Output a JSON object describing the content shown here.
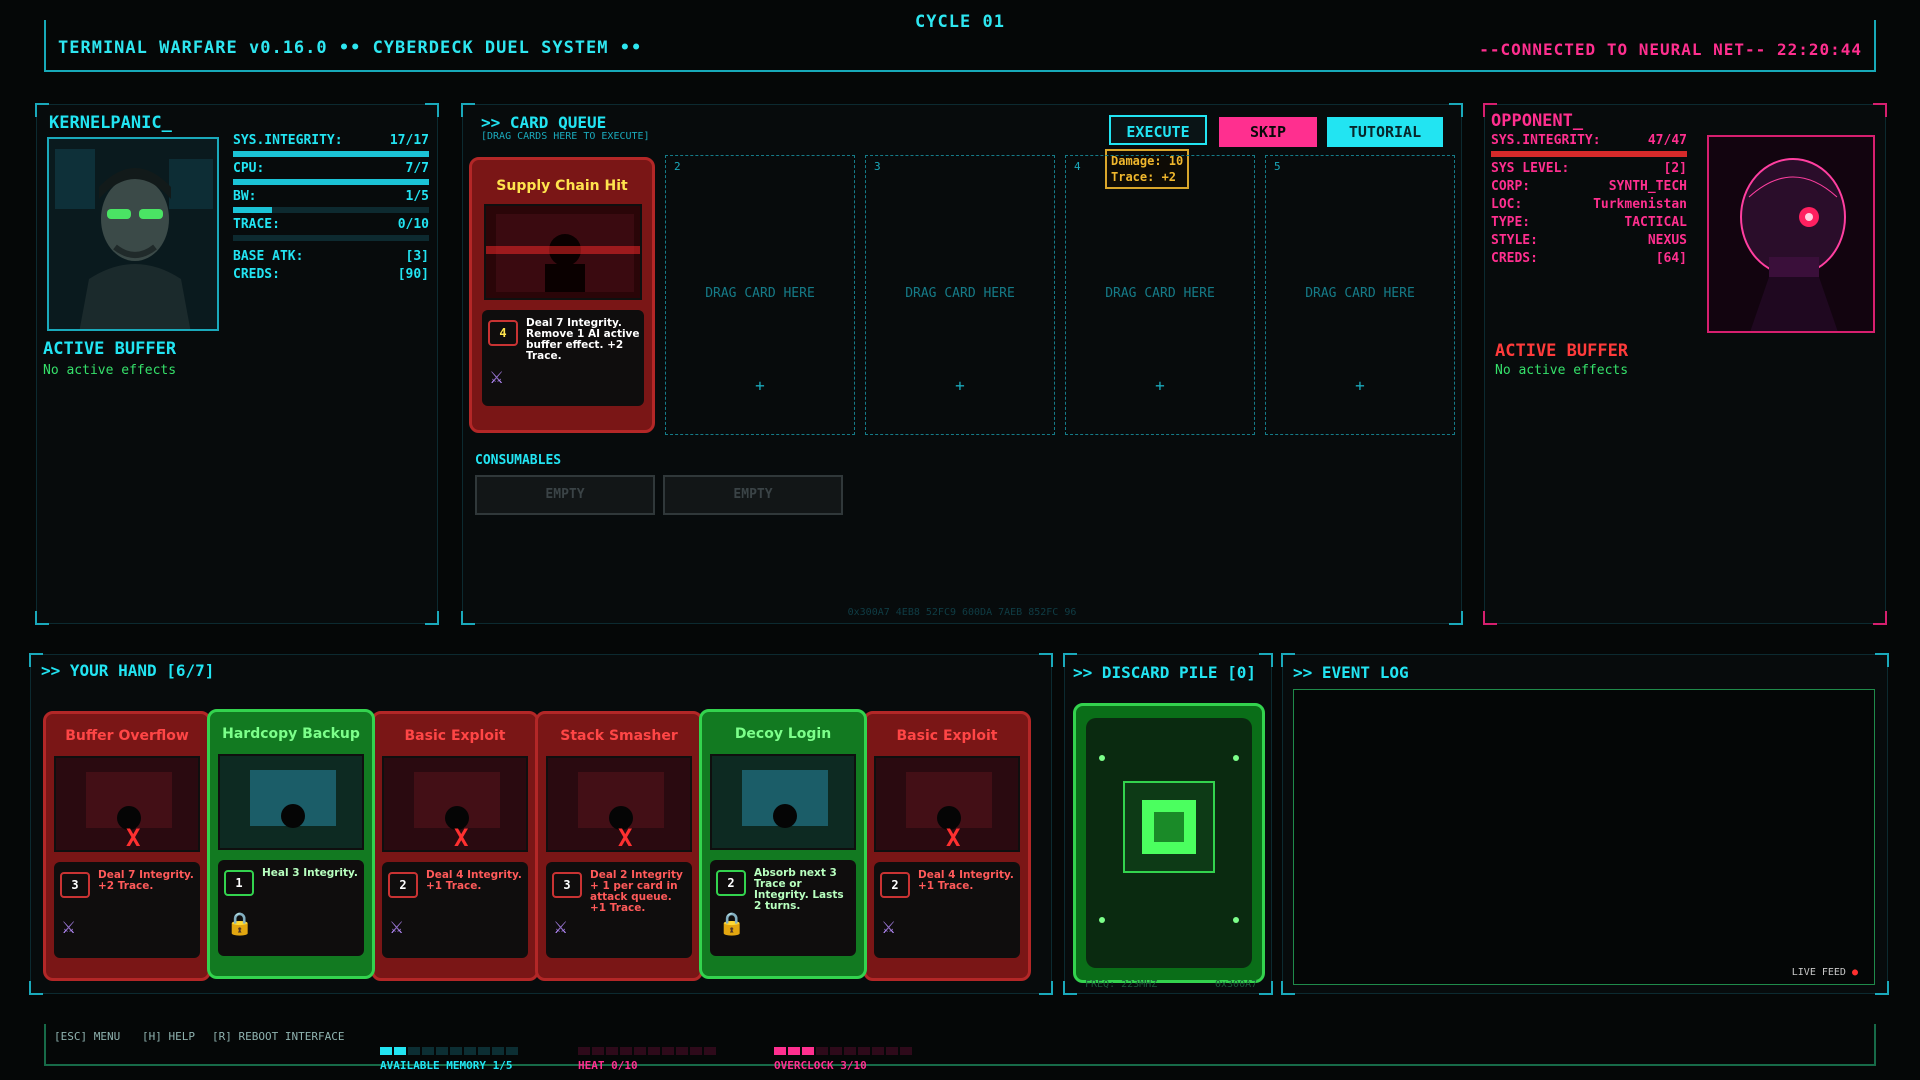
{
  "header": {
    "title": "TERMINAL WARFARE  v0.16.0  •• CYBERDECK DUEL SYSTEM ••",
    "cycle": "CYCLE 01",
    "connection": "--CONNECTED TO NEURAL NET--  22:20:44"
  },
  "player": {
    "name": "KERNELPANIC_",
    "stats": [
      {
        "label": "SYS.INTEGRITY:",
        "value": "17/17",
        "fill": 1.0
      },
      {
        "label": "CPU:",
        "value": "7/7",
        "fill": 1.0
      },
      {
        "label": "BW:",
        "value": "1/5",
        "fill": 0.2
      },
      {
        "label": "TRACE:",
        "value": "0/10",
        "fill": 0.0
      }
    ],
    "base_atk_label": "BASE ATK:",
    "base_atk": "[3]",
    "creds_label": "CREDS:",
    "creds": "[90]",
    "buffer_title": "ACTIVE BUFFER",
    "buffer_status": "No active effects"
  },
  "queue": {
    "title": ">> CARD QUEUE",
    "subtitle": "[DRAG CARDS HERE TO EXECUTE]",
    "execute_label": "EXECUTE",
    "skip_label": "SKIP",
    "tutorial_label": "TUTORIAL",
    "tooltip_line1": "Damage: 10",
    "tooltip_line2": "Trace: +2",
    "slot_numbers": [
      "2",
      "3",
      "4",
      "5"
    ],
    "drag_label": "DRAG CARD HERE",
    "plus": "+",
    "queued_card": {
      "name": "Supply Chain Hit",
      "cost": "4",
      "text": "Deal 7 Integrity. Remove 1 AI active buffer effect. +2 Trace."
    },
    "consumables_title": "CONSUMABLES",
    "consumable_slots": [
      "EMPTY",
      "EMPTY"
    ],
    "hex_footer": "0x300A7 4EB8 52FC9 600DA 7AEB 852FC 96"
  },
  "opponent": {
    "name": "OPPONENT_",
    "integrity_label": "SYS.INTEGRITY:",
    "integrity": "47/47",
    "integrity_fill": 1.0,
    "fields": [
      {
        "label": "SYS LEVEL:",
        "value": "[2]"
      },
      {
        "label": "CORP:",
        "value": "SYNTH_TECH"
      },
      {
        "label": "LOC:",
        "value": "Turkmenistan"
      },
      {
        "label": "TYPE:",
        "value": "TACTICAL"
      },
      {
        "label": "STYLE:",
        "value": "NEXUS"
      },
      {
        "label": "CREDS:",
        "value": "[64]"
      }
    ],
    "buffer_title": "ACTIVE BUFFER",
    "buffer_status": "No active effects"
  },
  "hand": {
    "title": ">> YOUR HAND [6/7]",
    "cards": [
      {
        "name": "Buffer Overflow",
        "cost": "3",
        "text": "Deal 7 Integrity. +2 Trace.",
        "kind": "attack"
      },
      {
        "name": "Hardcopy Backup",
        "cost": "1",
        "text": "Heal 3 Integrity.",
        "kind": "defense"
      },
      {
        "name": "Basic Exploit",
        "cost": "2",
        "text": "Deal 4 Integrity. +1 Trace.",
        "kind": "attack"
      },
      {
        "name": "Stack Smasher",
        "cost": "3",
        "text": "Deal 2 Integrity + 1 per card in attack queue. +1 Trace.",
        "kind": "attack"
      },
      {
        "name": "Decoy Login",
        "cost": "2",
        "text": "Absorb next 3 Trace or Integrity. Lasts 2 turns.",
        "kind": "defense"
      },
      {
        "name": "Basic Exploit",
        "cost": "2",
        "text": "Deal 4 Integrity. +1 Trace.",
        "kind": "attack"
      }
    ],
    "x_mark": "X"
  },
  "discard": {
    "title": ">> DISCARD PILE [0]",
    "footer_left": "FREQ: 223MHZ",
    "footer_right": "0x300A7"
  },
  "eventlog": {
    "title": ">> EVENT LOG",
    "live": "LIVE FEED"
  },
  "footer": {
    "keys": [
      "[ESC] MENU",
      "[H] HELP",
      "[R] REBOOT INTERFACE"
    ],
    "memory_label": "AVAILABLE MEMORY 1/5",
    "memory_fill": 0.2,
    "heat_label": "HEAT 0/10",
    "heat_fill": 0.0,
    "overclock_label": "OVERCLOCK 3/10",
    "overclock_fill": 0.3
  },
  "colors": {
    "cyan": "#22e4f2",
    "magenta": "#ff2f8f",
    "red": "#ff3b3b",
    "green": "#35e06a",
    "amber": "#f0b72d"
  }
}
